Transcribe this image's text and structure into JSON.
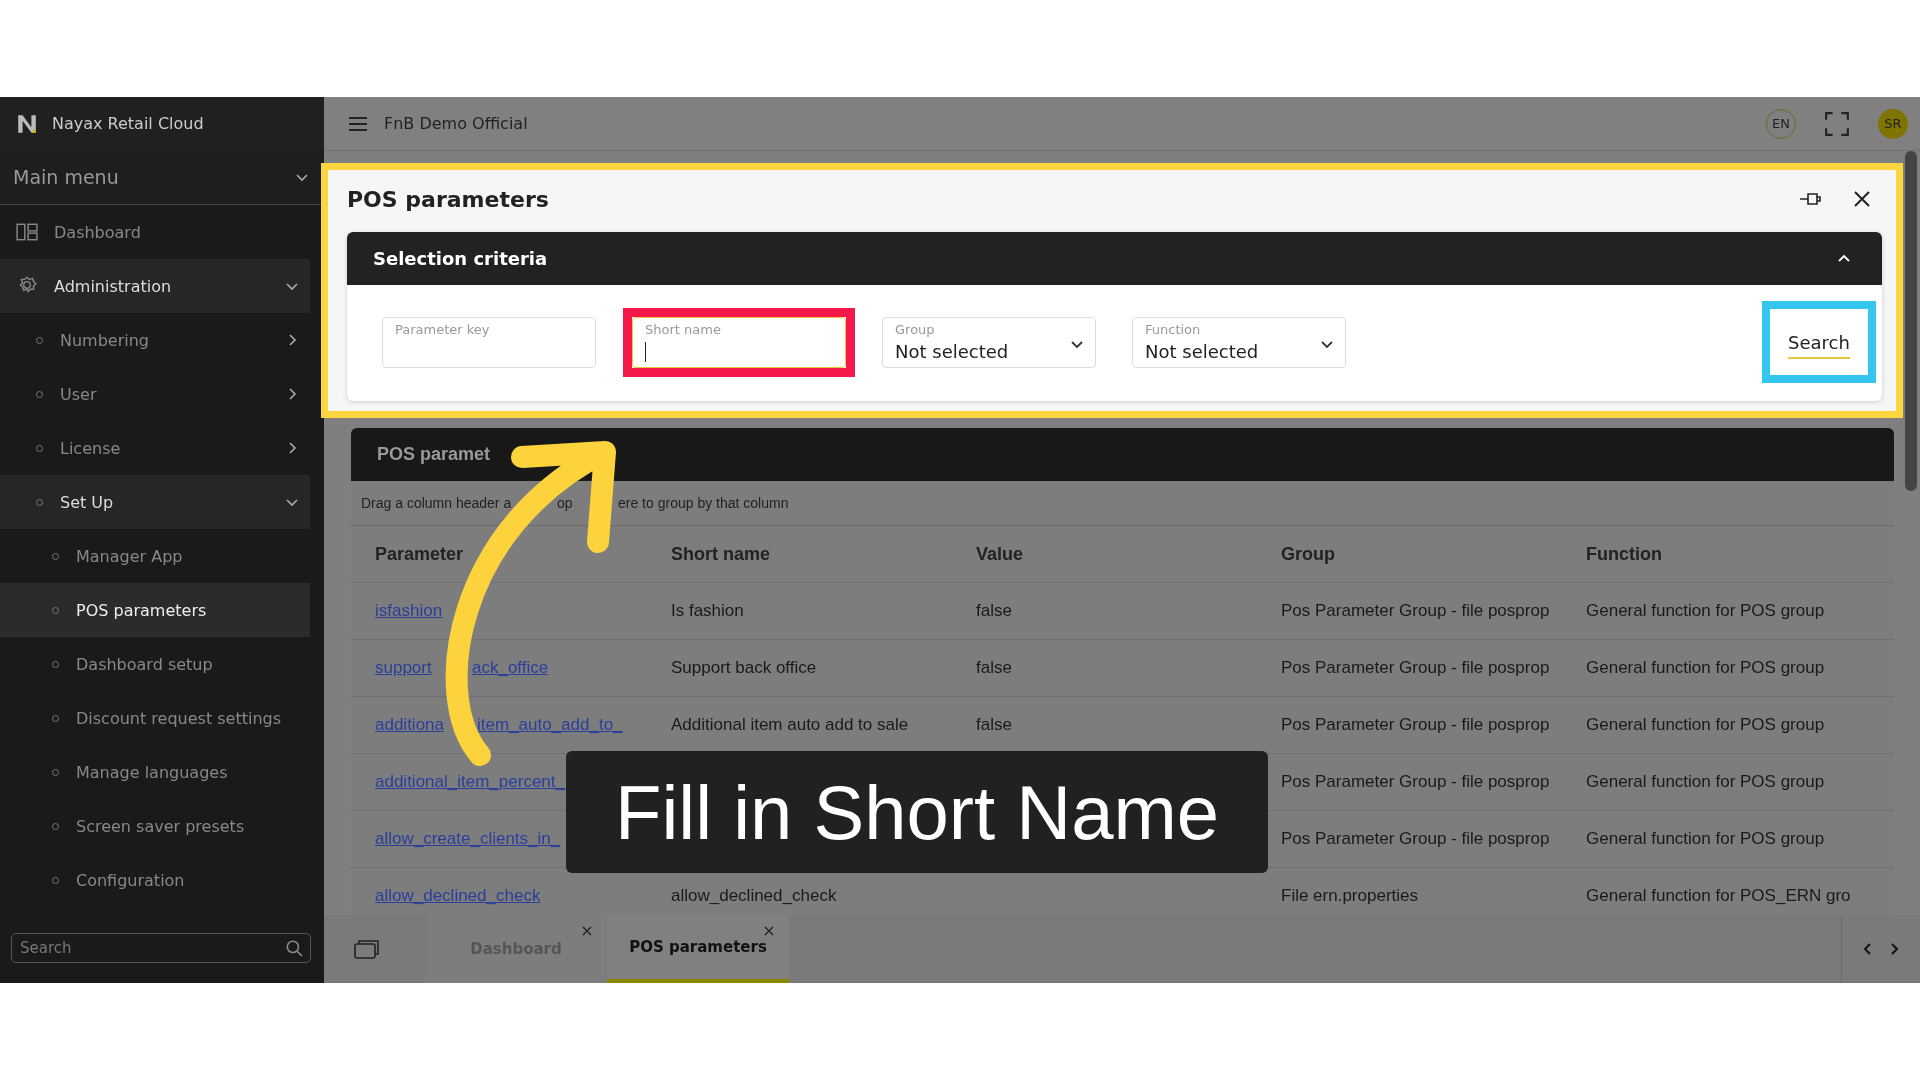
{
  "sidebar": {
    "brand": "Nayax Retail Cloud",
    "menu_title": "Main menu",
    "search_placeholder": "Search",
    "items": [
      {
        "label": "Dashboard",
        "selected": false
      },
      {
        "label": "Administration",
        "selected": false,
        "expanded": true,
        "children": [
          {
            "label": "Numbering",
            "selected": false,
            "expanded": false
          },
          {
            "label": "User",
            "selected": false,
            "expanded": false
          },
          {
            "label": "License",
            "selected": false,
            "expanded": false
          },
          {
            "label": "Set Up",
            "selected": false,
            "expanded": true,
            "children": [
              {
                "label": "Manager App",
                "selected": false
              },
              {
                "label": "POS parameters",
                "selected": true
              },
              {
                "label": "Dashboard setup",
                "selected": false
              },
              {
                "label": "Discount request settings",
                "selected": false
              },
              {
                "label": "Manage languages",
                "selected": false
              },
              {
                "label": "Screen saver presets",
                "selected": false
              },
              {
                "label": "Configuration",
                "selected": false
              }
            ]
          }
        ]
      }
    ]
  },
  "header": {
    "company": "FnB Demo Official",
    "language": "EN",
    "avatar": "SR"
  },
  "dialog": {
    "title": "POS parameters",
    "criteria": {
      "title": "Selection criteria",
      "expanded": true,
      "fields": [
        {
          "kind": "text",
          "label": "Parameter key",
          "focused": false,
          "highlighted": false
        },
        {
          "kind": "text",
          "label": "Short name",
          "focused": true,
          "highlighted": true
        },
        {
          "kind": "select",
          "label": "Group",
          "value": "Not selected",
          "focused": false,
          "highlighted": false
        },
        {
          "kind": "select",
          "label": "Function",
          "value": "Not selected",
          "focused": false,
          "highlighted": false
        }
      ],
      "search_button": {
        "label": "Search",
        "highlighted": true
      }
    }
  },
  "table": {
    "title": "POS paramet",
    "group_hint": [
      "Drag a column header a",
      "op",
      "ere to group by that column"
    ],
    "columns": [
      "Parameter",
      "Short name",
      "Value",
      "Group",
      "Function"
    ],
    "rows": [
      [
        [
          "isfashion"
        ],
        "Is fashion",
        "false",
        "Pos Parameter Group - file posprop",
        "General function for POS group"
      ],
      [
        [
          "support",
          "ack_office"
        ],
        "Support back office",
        "false",
        "Pos Parameter Group - file posprop",
        "General function for POS group"
      ],
      [
        [
          "additiona",
          "item_auto_add_to_"
        ],
        "Additional item auto add to sale",
        "false",
        "Pos Parameter Group - file posprop",
        "General function for POS group"
      ],
      [
        [
          "additional_item_percent_"
        ],
        null,
        null,
        "Pos Parameter Group - file posprop",
        "General function for POS group"
      ],
      [
        [
          "allow_create_clients_in_"
        ],
        null,
        null,
        "Pos Parameter Group - file posprop",
        "General function for POS group"
      ],
      [
        [
          "allow_declined_check"
        ],
        "allow_declined_check",
        null,
        "File ern.properties",
        "General function for POS_ERN gro"
      ]
    ]
  },
  "tabs": [
    {
      "label": "Dashboard",
      "selected": false
    },
    {
      "label": "POS parameters",
      "selected": true
    }
  ],
  "annotation": {
    "caption": "Fill in Short Name"
  }
}
